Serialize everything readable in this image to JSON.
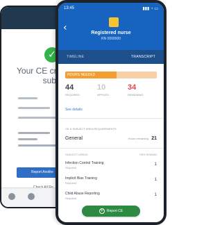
{
  "back_screen": {
    "title_line1": "Your CE credit",
    "title_line2": "submit",
    "report_button_label": "Report Anothe",
    "link_label": "Check All Re"
  },
  "front_screen": {
    "status_time": "13:45",
    "status_icons": "▮▮▮ ◔ ▭",
    "header_title": "Registered nurse",
    "header_subtitle": "RN 0000000",
    "tabs": [
      "TIMELINE",
      "TRANSCRIPT"
    ],
    "progress_label": "HOURS NEEDED",
    "progress_fraction": 0.56,
    "stats": [
      {
        "value": "44",
        "caption": "REQUIRED"
      },
      {
        "value": "10",
        "caption": "APPLIED"
      },
      {
        "value": "34",
        "caption": "REMAINING"
      }
    ],
    "section_link": "See details",
    "list_heading": "CE & SUBJECT AREA REQUIREMENTS",
    "general_label": "General",
    "general_meta": "Hours remaining",
    "general_count": "21",
    "subheads_left": "SUBJECT AREAS",
    "subheads_right": "HRS REMAIN",
    "items": [
      {
        "title": "Infection Control Training",
        "sub": "Required",
        "count": "1"
      },
      {
        "title": "Implicit Bias Training",
        "sub": "Required",
        "count": "1"
      },
      {
        "title": "Child Abuse Reporting",
        "sub": "Required",
        "count": "1"
      }
    ],
    "report_button": "Report CE",
    "colors": {
      "header_blue": "#1664c0",
      "progress_orange": "#f39c2f",
      "report_green": "#2c8a43",
      "remaining_red": "#e2474e"
    }
  }
}
